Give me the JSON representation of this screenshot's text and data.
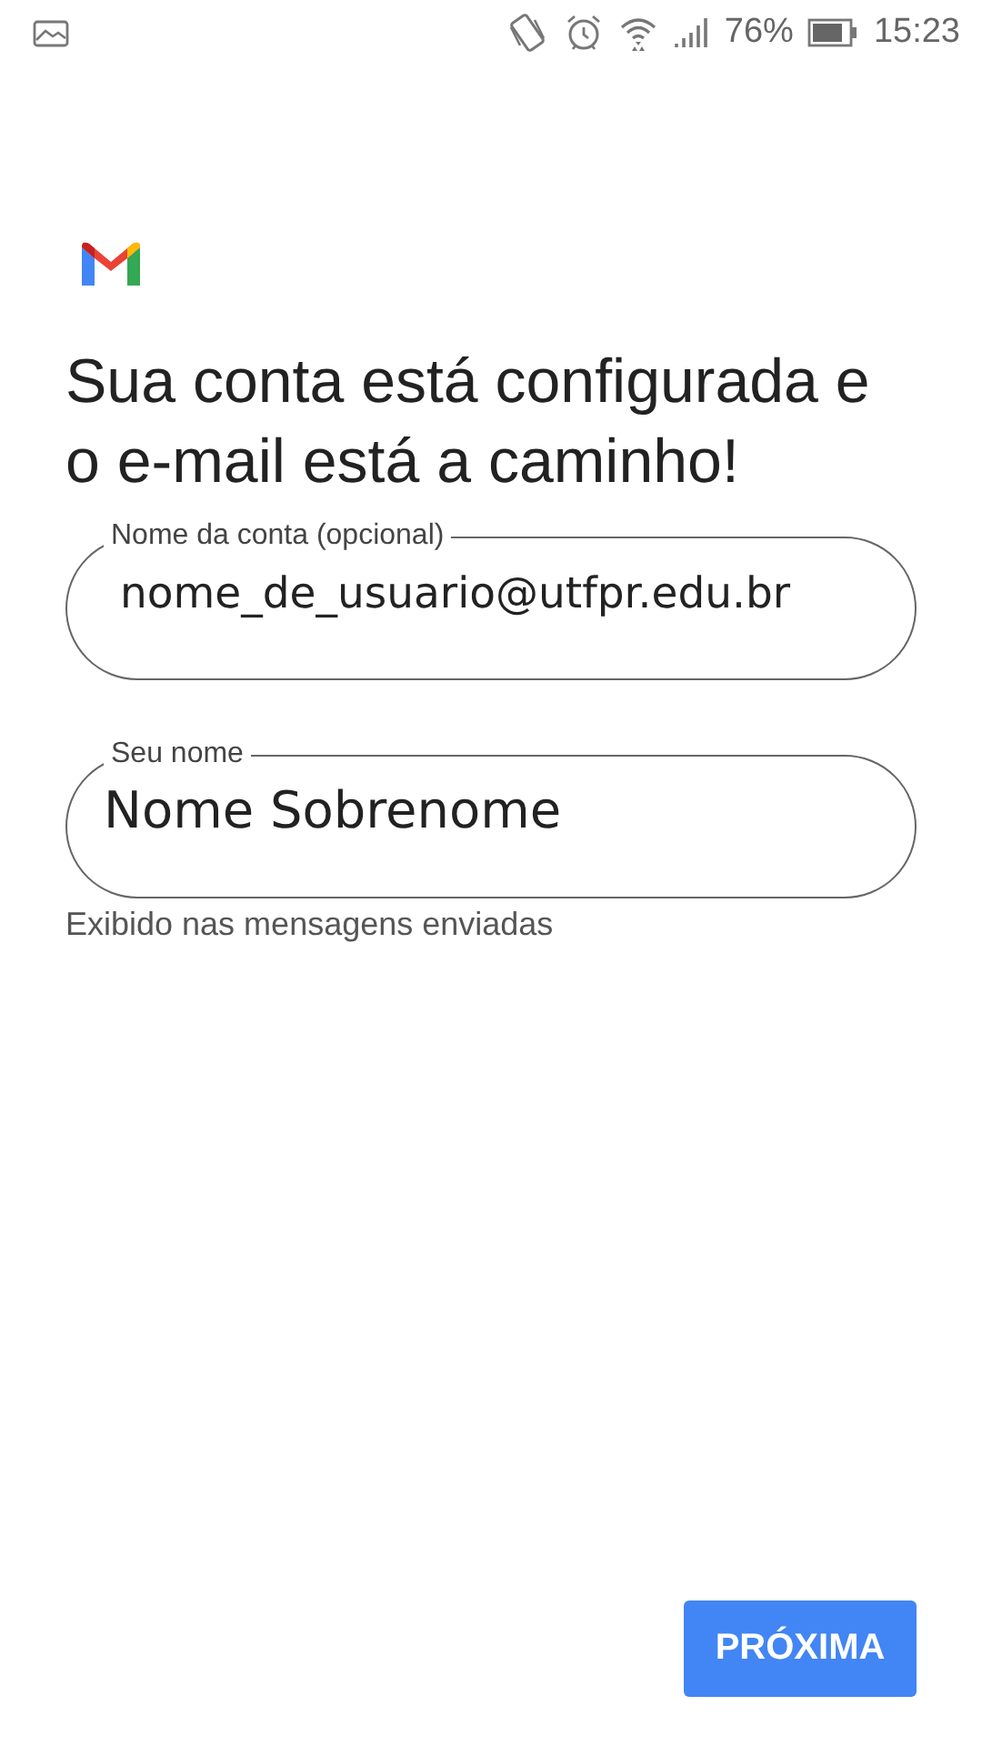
{
  "status_bar": {
    "battery": "76%",
    "time": "15:23"
  },
  "title": "Sua conta está configurada e o e-mail está a caminho!",
  "fields": [
    {
      "label": "Nome da conta (opcional)",
      "value": "nome_de_usuario@utfpr.edu.br"
    },
    {
      "label": "Seu nome",
      "value": "Nome Sobrenome",
      "helper": "Exibido nas mensagens enviadas"
    }
  ],
  "button": "PRÓXIMA"
}
